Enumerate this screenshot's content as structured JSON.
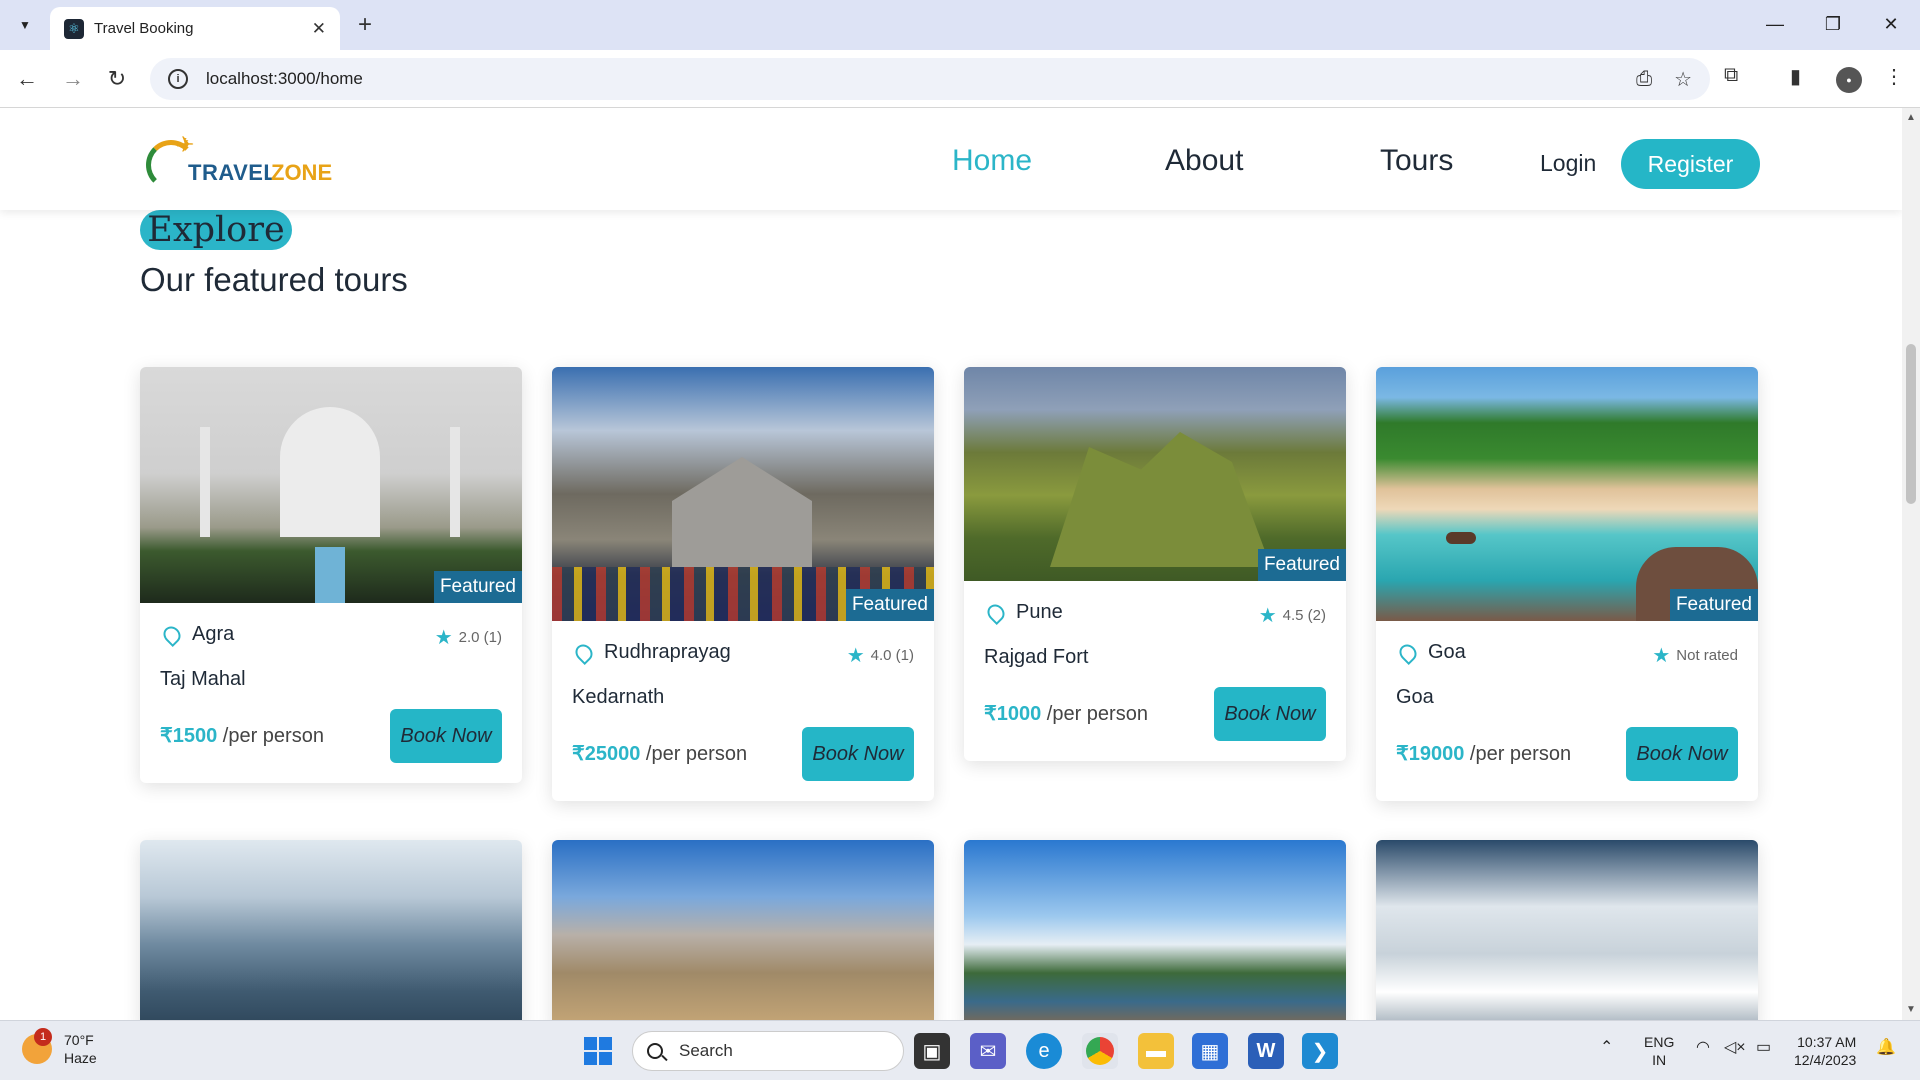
{
  "browser": {
    "tab_title": "Travel Booking",
    "tab_close": "✕",
    "new_tab": "+",
    "url": "localhost:3000/home",
    "window_controls": [
      "—",
      "❐",
      "✕"
    ]
  },
  "site": {
    "logo_word1": "TRAVEL",
    "logo_word2": "ZONE",
    "nav": [
      {
        "label": "Home",
        "active": true
      },
      {
        "label": "About",
        "active": false
      },
      {
        "label": "Tours",
        "active": false
      }
    ],
    "login_label": "Login",
    "register_label": "Register",
    "accent_color": "#2bb5c8",
    "badge_color": "#1c6b93"
  },
  "section": {
    "pill": "Explore",
    "title": "Our featured tours"
  },
  "tours": [
    {
      "city": "Agra",
      "rating": "2.0",
      "reviews": "(1)",
      "name": "Taj Mahal",
      "price": "₹1500",
      "per": "/per person",
      "badge": "Featured",
      "book": "Book Now"
    },
    {
      "city": "Rudhraprayag",
      "rating": "4.0",
      "reviews": "(1)",
      "name": "Kedarnath",
      "price": "₹25000",
      "per": "/per person",
      "badge": "Featured",
      "book": "Book Now"
    },
    {
      "city": "Pune",
      "rating": "4.5",
      "reviews": "(2)",
      "name": "Rajgad Fort",
      "price": "₹1000",
      "per": "/per person",
      "badge": "Featured",
      "book": "Book Now"
    },
    {
      "city": "Goa",
      "rating": "Not rated",
      "reviews": "",
      "name": "Goa",
      "price": "₹19000",
      "per": "/per person",
      "badge": "Featured",
      "book": "Book Now"
    }
  ],
  "taskbar": {
    "temp": "70°F",
    "condition": "Haze",
    "notif_count": "1",
    "search_label": "Search",
    "lang": "ENG",
    "region": "IN",
    "time": "10:37 AM",
    "date": "12/4/2023"
  }
}
